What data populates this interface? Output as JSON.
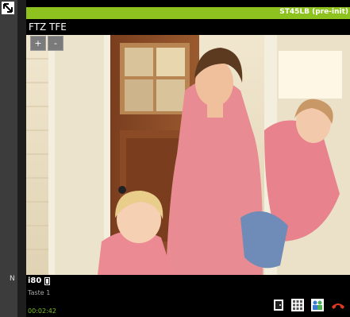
{
  "header": {
    "device_status": "ST45LB (pre-init)",
    "camera_title": "FTZ TFE"
  },
  "zoom": {
    "zoom_in_label": "+",
    "zoom_out_label": "-"
  },
  "left_rail": {
    "letter": "N"
  },
  "call": {
    "extension": "i80",
    "key_label": "Taste 1",
    "timer": "00:02:42"
  },
  "colors": {
    "accent_green": "#8dc21f",
    "timer_green": "#7bbf1e",
    "hangup_red": "#e03a1e"
  },
  "icons": {
    "door": "door-icon",
    "keypad": "keypad-icon",
    "group": "group-icon",
    "hangup": "hangup-icon"
  }
}
